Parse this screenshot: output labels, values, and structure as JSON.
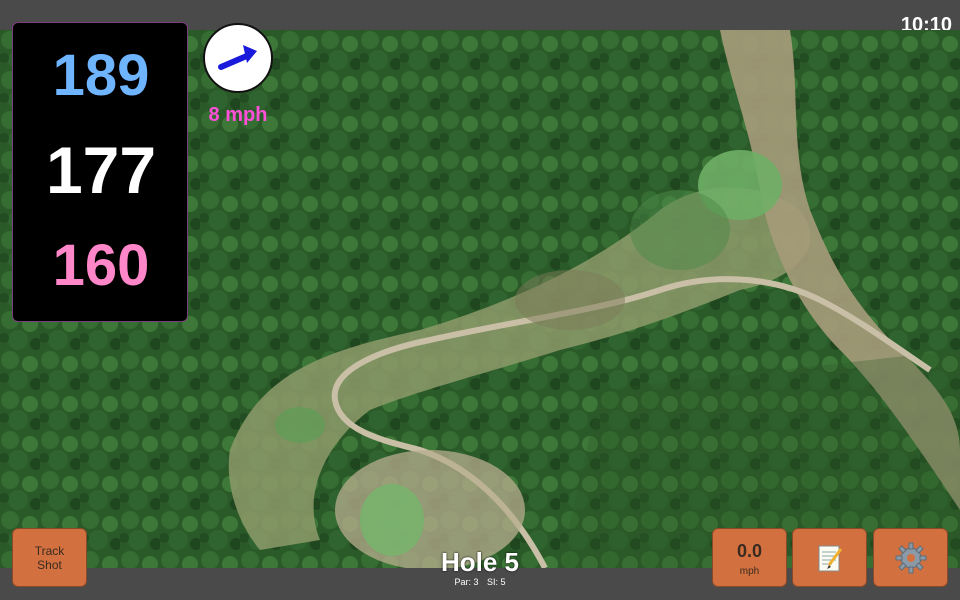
{
  "status": {
    "time": "10:10"
  },
  "distances": {
    "back": "189",
    "middle": "177",
    "front": "160",
    "colors": {
      "back": "#6fb4ff",
      "middle": "#ffffff",
      "front": "#ff86c8"
    }
  },
  "wind": {
    "speed": "8 mph",
    "icon": "arrow-right-up-icon",
    "arrow_color": "#1a1adc"
  },
  "buttons": {
    "track_shot_line1": "Track",
    "track_shot_line2": "Shot",
    "speed_value": "0.0",
    "speed_unit": "mph",
    "notes_icon": "notepad-icon",
    "settings_icon": "gear-icon"
  },
  "hole": {
    "title": "Hole 5",
    "par": "Par: 3",
    "si": "SI: 5"
  },
  "colors": {
    "button_bg": "#d2713f",
    "accent_border": "#7a3f7f"
  }
}
